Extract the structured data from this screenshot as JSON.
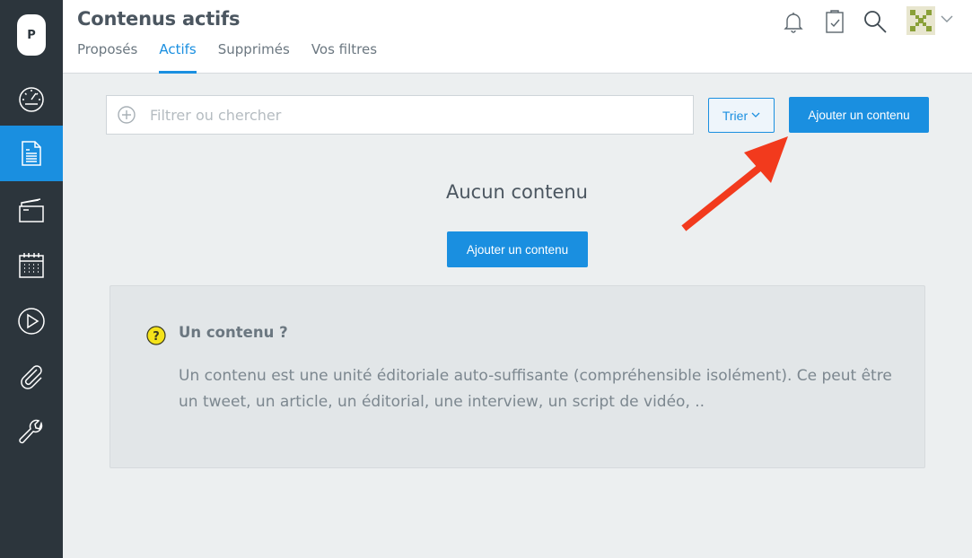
{
  "sidebar": {
    "logo_letter": "P",
    "items": [
      {
        "icon": "dashboard-icon"
      },
      {
        "icon": "document-icon",
        "active": true
      },
      {
        "icon": "folder-icon"
      },
      {
        "icon": "calendar-icon"
      },
      {
        "icon": "play-icon"
      },
      {
        "icon": "attachment-icon"
      },
      {
        "icon": "wrench-icon"
      }
    ]
  },
  "header": {
    "title": "Contenus actifs",
    "tabs": [
      {
        "label": "Proposés"
      },
      {
        "label": "Actifs",
        "active": true
      },
      {
        "label": "Supprimés"
      },
      {
        "label": "Vos filtres"
      }
    ],
    "icons": [
      "bell-icon",
      "clipboard-check-icon",
      "search-icon",
      "avatar",
      "chevron-down-icon"
    ]
  },
  "toolbar": {
    "search_placeholder": "Filtrer ou chercher",
    "sort_label": "Trier",
    "add_label": "Ajouter un contenu"
  },
  "empty_state": {
    "title": "Aucun contenu",
    "add_label": "Ajouter un contenu"
  },
  "info": {
    "title": "Un contenu ?",
    "text": "Un contenu est une unité éditoriale auto-suffisante (compréhensible isolément). Ce peut être un tweet, un article, un éditorial, une interview, un script de vidéo, .."
  },
  "colors": {
    "accent": "#1a8fe0",
    "sidebar": "#2c353c",
    "annotation_arrow": "#f23a1d"
  }
}
